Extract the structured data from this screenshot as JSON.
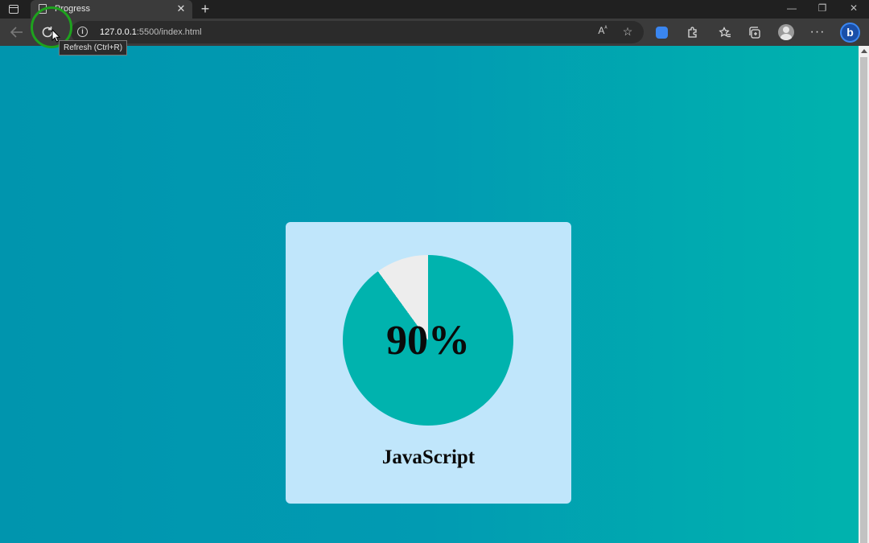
{
  "browser": {
    "tab_title": "Progress",
    "url_host": "127.0.0.1",
    "url_rest": ":5500/index.html",
    "tooltip": "Refresh (Ctrl+R)",
    "new_tab_symbol": "+",
    "close_symbol": "✕"
  },
  "window_controls": {
    "minimize": "—",
    "restore": "❐",
    "close": "✕"
  },
  "icons": {
    "back": "back-arrow-icon",
    "refresh": "refresh-icon",
    "info": "info-icon",
    "read_aloud": "read-aloud-icon",
    "favorite": "add-favorite-icon",
    "extensions": "puzzle-icon",
    "favorites": "favorites-icon",
    "collections": "collections-icon",
    "more": "more-icon",
    "bing": "bing-icon"
  },
  "colors": {
    "progress_fill": "#00b3ae",
    "progress_track": "#ededed",
    "card_bg": "#c0e6fb",
    "highlight_ring": "#1ea21e"
  },
  "card": {
    "progress": 90,
    "progress_label": "90%",
    "skill": "JavaScript"
  }
}
